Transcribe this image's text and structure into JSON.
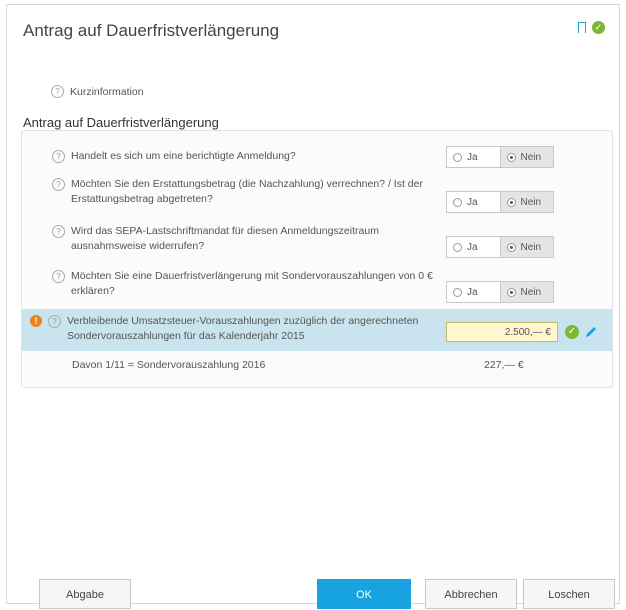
{
  "header": {
    "title": "Antrag auf Dauerfristverlängerung",
    "status_color": "#7cb82f"
  },
  "info": {
    "help_glyph": "?",
    "kurzinformation": "Kurzinformation"
  },
  "section": {
    "title": "Antrag auf Dauerfristverlängerung"
  },
  "questions": [
    {
      "text": "Handelt es sich um eine berichtigte Anmeldung?",
      "options": [
        "Ja",
        "Nein"
      ],
      "selected": "Nein"
    },
    {
      "text": "Möchten Sie den Erstattungsbetrag (die Nachzahlung) verrechnen? / Ist der Erstattungsbetrag abgetreten?",
      "options": [
        "Ja",
        "Nein"
      ],
      "selected": "Nein"
    },
    {
      "text": "Wird das SEPA-Lastschriftmandat für diesen Anmeldungszeitraum ausnahmsweise widerrufen?",
      "options": [
        "Ja",
        "Nein"
      ],
      "selected": "Nein"
    },
    {
      "text": "Möchten Sie eine Dauerfristverlängerung mit Sondervorauszahlungen von 0 € erklären?",
      "options": [
        "Ja",
        "Nein"
      ],
      "selected": "Nein"
    }
  ],
  "highlighted_field": {
    "warning_glyph": "!",
    "label": "Verbleibende Umsatzsteuer-Vorauszahlungen zuzüglich der angerechneten Sondervorauszahlungen für das Kalenderjahr 2015",
    "value": "2.500,— €",
    "confirm_glyph": "✓"
  },
  "summary": {
    "label": "Davon 1/11 = Sondervorauszahlung 2016",
    "value": "227,— €"
  },
  "footer": {
    "abgabe": "Abgabe",
    "ok": "OK",
    "abbrechen": "Abbrechen",
    "loschen": "Loschen"
  },
  "colors": {
    "accent": "#16a3e0",
    "highlight": "#c9e4ee",
    "warning": "#e8841a",
    "success": "#7cb82f"
  }
}
